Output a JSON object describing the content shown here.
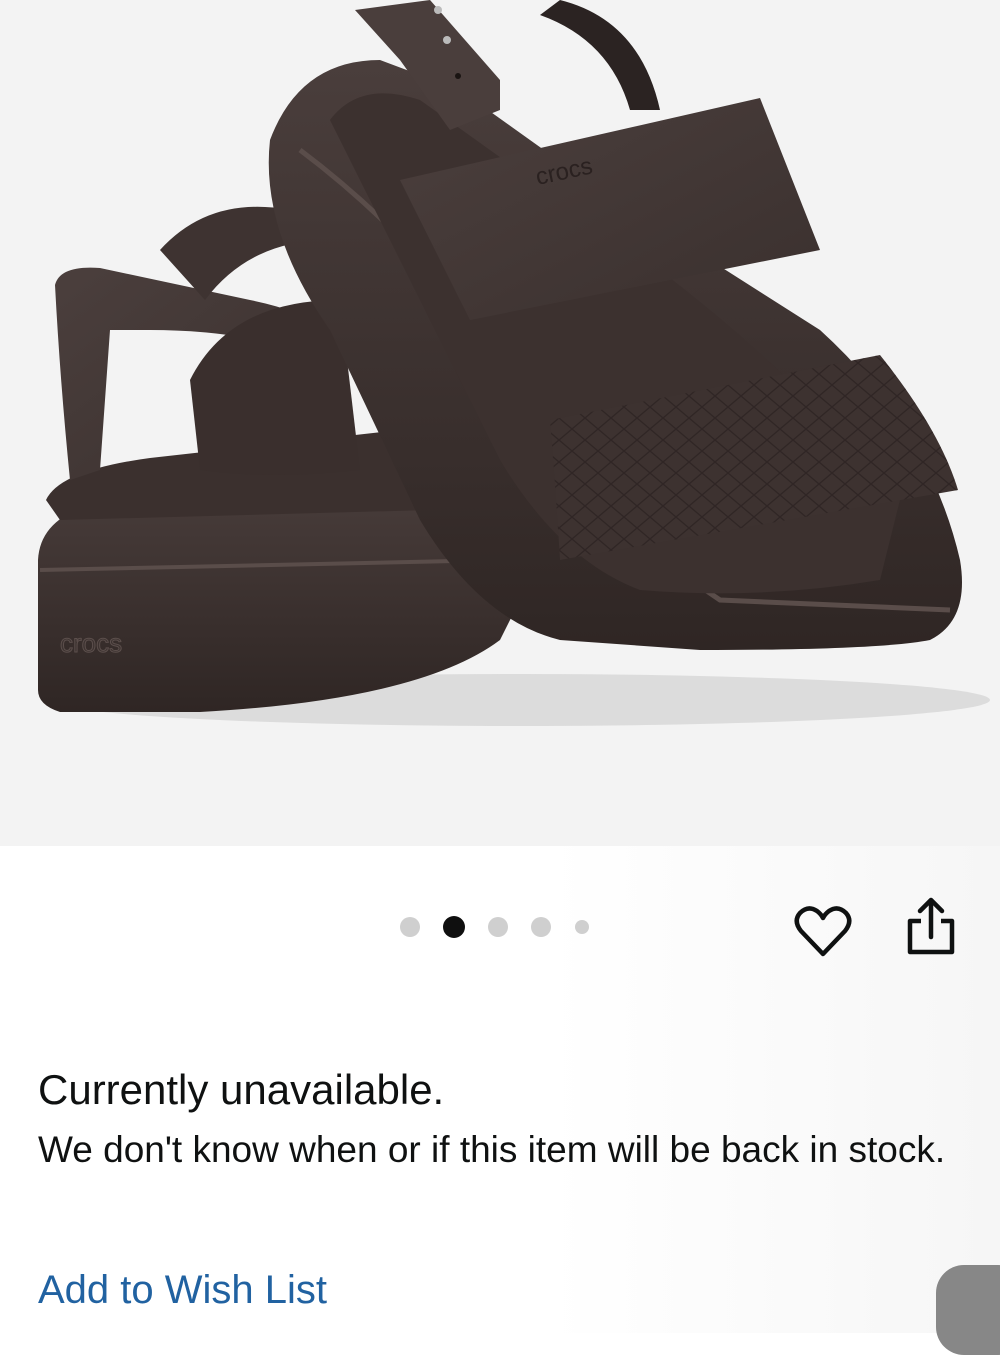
{
  "product": {
    "image_alt": "Brown platform sandals with croc-embossed toe strap",
    "brand_mark": "crocs"
  },
  "carousel": {
    "total_images": 5,
    "active_index": 1
  },
  "actions": {
    "wishlist_icon": "heart-icon",
    "share_icon": "share-icon"
  },
  "availability": {
    "title": "Currently unavailable.",
    "message": "We don't know when or if this item will be back in stock."
  },
  "links": {
    "add_to_wish_list": "Add to Wish List"
  },
  "colors": {
    "link": "#2162a1",
    "active_dot": "#0f0f0f",
    "inactive_dot": "#cfcfcf"
  }
}
